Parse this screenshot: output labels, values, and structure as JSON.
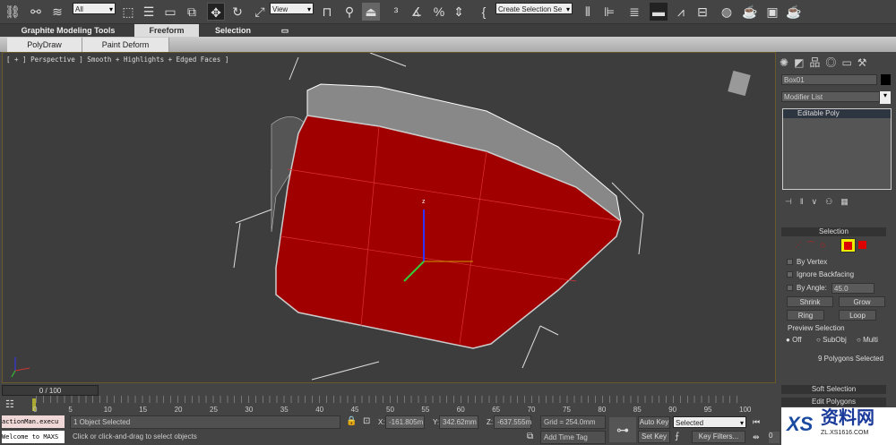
{
  "toolbar": {
    "selection_filter": "All",
    "ref_coord": "View",
    "named_selection": "Create Selection Se",
    "icons": [
      "select-link-icon",
      "unlink-icon",
      "bind-spacewarp-icon",
      "select-object-icon",
      "select-by-name-icon",
      "rect-region-icon",
      "window-crossing-icon",
      "move-icon",
      "rotate-icon",
      "scale-icon",
      "pivot-icon",
      "manipulate-icon",
      "keyboard-shortcut-icon",
      "snap-3d-icon",
      "angle-snap-icon",
      "percent-snap-icon",
      "spinner-snap-icon",
      "edit-named-sel-icon",
      "mirror-icon",
      "align-icon",
      "layer-manager-icon",
      "graphite-toggle-icon",
      "curve-editor-icon",
      "schematic-view-icon",
      "material-editor-icon",
      "render-setup-icon",
      "rendered-frame-icon",
      "render-icon"
    ]
  },
  "ribbon": {
    "tabs": [
      "Graphite Modeling Tools",
      "Freeform",
      "Selection"
    ],
    "active": "Freeform",
    "sub_tabs": [
      "PolyDraw",
      "Paint Deform"
    ]
  },
  "viewport": {
    "label": "[ + ] Perspective ] Smooth + Highlights + Edged Faces ]",
    "axis_z": "z",
    "poly_color": "#a00000"
  },
  "command_panel": {
    "tabs": [
      "create-icon",
      "modify-icon",
      "hierarchy-icon",
      "motion-icon",
      "display-icon",
      "utilities-icon"
    ],
    "object_name": "Box01",
    "modifier_list": "Modifier List",
    "stack": [
      "Editable Poly"
    ],
    "selection": {
      "title": "Selection",
      "by_vertex": "By Vertex",
      "ignore_backfacing": "Ignore Backfacing",
      "by_angle": "By Angle:",
      "angle": "45.0",
      "shrink": "Shrink",
      "grow": "Grow",
      "ring": "Ring",
      "loop": "Loop",
      "preview": "Preview Selection",
      "off": "Off",
      "subobj": "SubObj",
      "multi": "Multi",
      "count": "9 Polygons Selected"
    },
    "soft_selection": "Soft Selection",
    "edit_polygons": "Edit Polygons"
  },
  "timeline": {
    "slider": "0 / 100",
    "ticks": [
      "0",
      "5",
      "10",
      "15",
      "20",
      "25",
      "30",
      "35",
      "40",
      "45",
      "50",
      "55",
      "60",
      "65",
      "70",
      "75",
      "80",
      "85",
      "90",
      "95",
      "100"
    ]
  },
  "status": {
    "maxscript1": "actionMan.execu",
    "maxscript2": "Welcome to MAXS",
    "selected": "1 Object Selected",
    "prompt": "Click or click-and-drag to select objects",
    "x": "-161.805m",
    "y": "342.62mm",
    "z": "-637.555m",
    "grid": "Grid = 254.0mm",
    "add_time_tag": "Add Time Tag",
    "auto_key": "Auto Key",
    "set_key": "Set Key",
    "key_mode": "Selected",
    "key_filters": "Key Filters...",
    "frame": "0"
  },
  "watermark": {
    "text": "资料网",
    "url": "ZL.XS1616.COM"
  }
}
